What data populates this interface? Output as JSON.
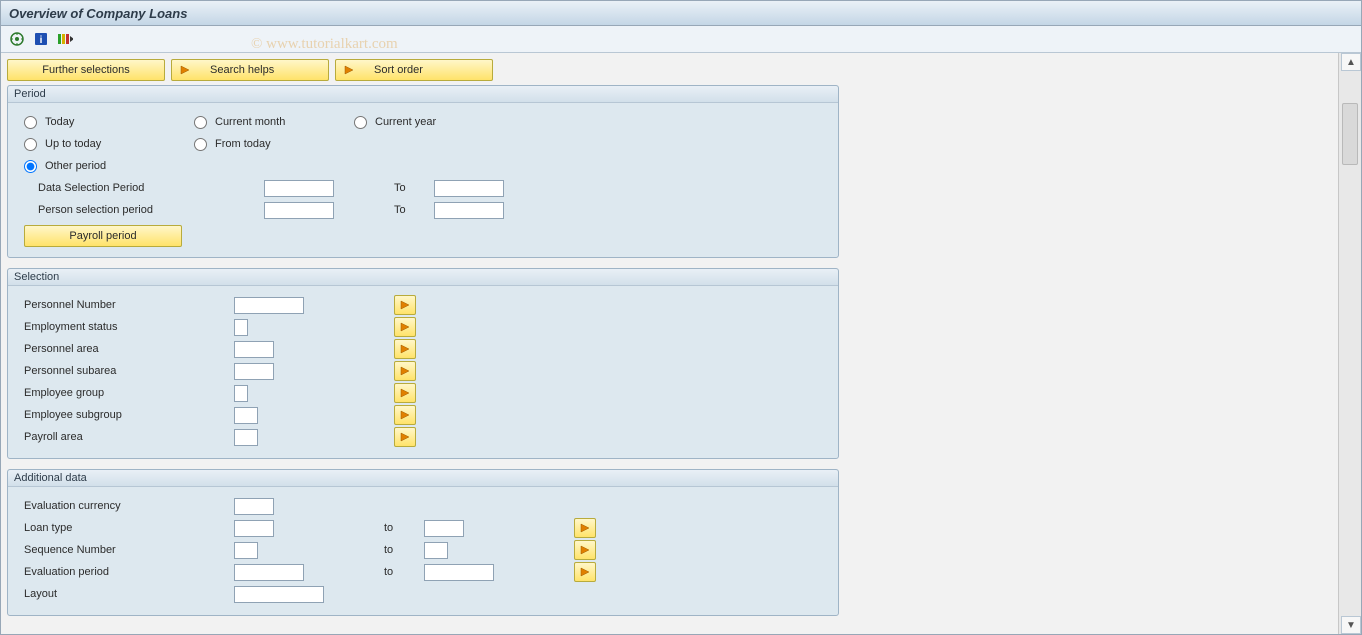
{
  "title": "Overview of Company Loans",
  "watermark": "© www.tutorialkart.com",
  "actions": {
    "further_selections": "Further selections",
    "search_helps": "Search helps",
    "sort_order": "Sort order"
  },
  "period": {
    "legend": "Period",
    "today": "Today",
    "current_month": "Current month",
    "current_year": "Current year",
    "up_to_today": "Up to today",
    "from_today": "From today",
    "other_period": "Other period",
    "data_selection_period": "Data Selection Period",
    "person_selection_period": "Person selection period",
    "to": "To",
    "payroll_period_btn": "Payroll period",
    "selected": "other_period"
  },
  "selection": {
    "legend": "Selection",
    "fields": [
      {
        "label": "Personnel Number",
        "width": "w70"
      },
      {
        "label": "Employment status",
        "width": "w14"
      },
      {
        "label": "Personnel area",
        "width": "w40"
      },
      {
        "label": "Personnel subarea",
        "width": "w40"
      },
      {
        "label": "Employee group",
        "width": "w14"
      },
      {
        "label": "Employee subgroup",
        "width": "w30"
      },
      {
        "label": "Payroll area",
        "width": "w30"
      }
    ]
  },
  "additional": {
    "legend": "Additional data",
    "eval_currency": "Evaluation currency",
    "loan_type": "Loan type",
    "sequence_number": "Sequence Number",
    "evaluation_period": "Evaluation period",
    "layout": "Layout",
    "to": "to"
  }
}
